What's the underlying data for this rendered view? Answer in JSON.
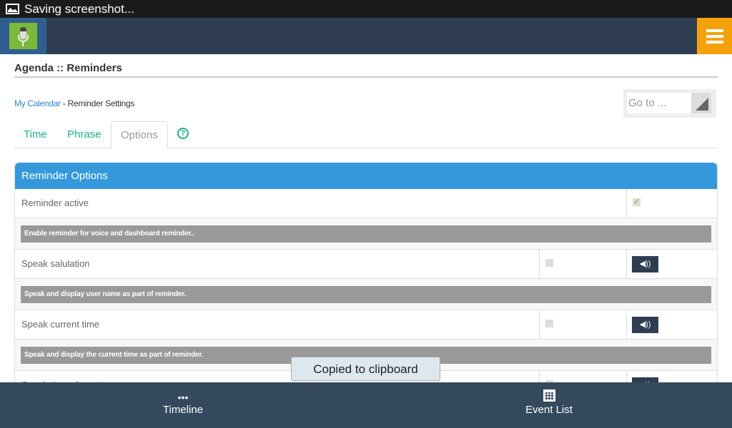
{
  "status_bar": {
    "text": "Saving screenshot..."
  },
  "header": {
    "title": "Agenda :: Reminders"
  },
  "breadcrumb": {
    "link": "My Calendar",
    "current": " - Reminder Settings"
  },
  "goto": {
    "placeholder": "Go to ..."
  },
  "tabs": [
    {
      "label": "Time"
    },
    {
      "label": "Phrase"
    },
    {
      "label": "Options",
      "active": true
    }
  ],
  "panel": {
    "title": "Reminder Options",
    "rows": [
      {
        "label": "Reminder active",
        "checked": true
      },
      {
        "note": "Enable reminder for voice and dashboard reminder.."
      },
      {
        "label": "Speak salulation",
        "checked": false
      },
      {
        "note": "Speak and display user name as part of reminder."
      },
      {
        "label": "Speak current time",
        "checked": false
      },
      {
        "note": "Speak and display the current time as part of reminder."
      },
      {
        "label": "Speak time of event",
        "checked": false
      }
    ]
  },
  "toast": "Copied to clipboard",
  "bottom_nav": [
    {
      "label": "Timeline",
      "icon": "ellipsis-icon"
    },
    {
      "label": "Event List",
      "icon": "calendar-icon"
    }
  ],
  "colors": {
    "header": "#2e3e50",
    "accent": "#3498db",
    "menu": "#f4a20b",
    "tab": "#1fb089"
  }
}
